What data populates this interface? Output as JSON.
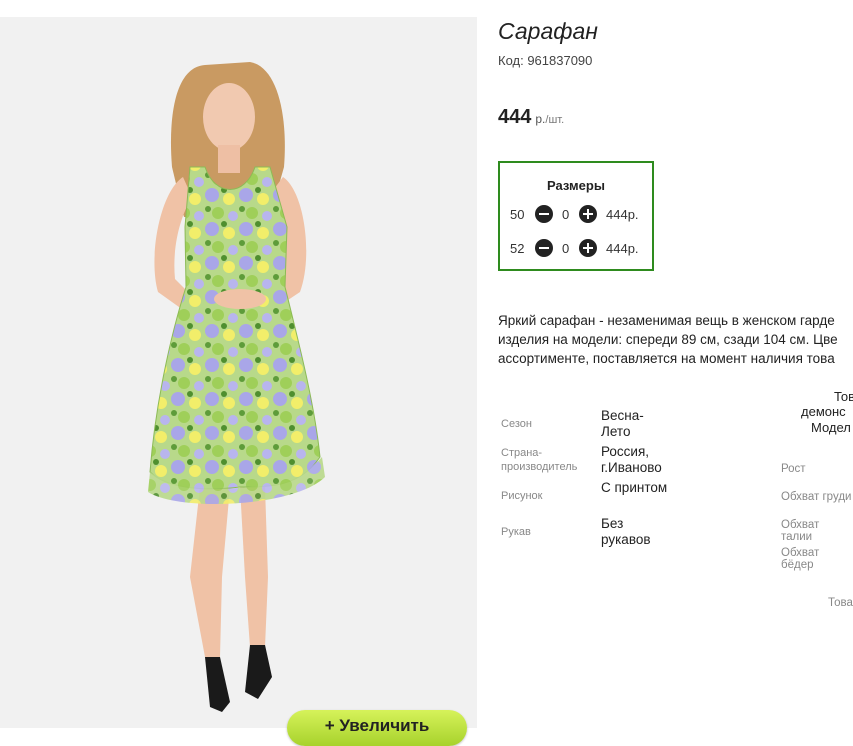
{
  "product": {
    "title": "Сарафан",
    "code": "Код: 961837090",
    "price": "444",
    "price_unit": "р.",
    "price_per": "/шт."
  },
  "sizes": {
    "title": "Размеры",
    "rows": [
      {
        "size": "50",
        "qty": "0",
        "price": "444р."
      },
      {
        "size": "52",
        "qty": "0",
        "price": "444р."
      }
    ]
  },
  "description": {
    "line1": "Яркий сарафан - незаменимая вещь в женском гарде",
    "line2": "изделия на модели: спереди 89 см, сзади 104 см. Цве",
    "line3": "ассортименте, поставляется на момент наличия това"
  },
  "properties": [
    {
      "label": "Сезон",
      "value": "Весна-Лето"
    },
    {
      "label": "Страна-производитель",
      "value": "Россия, г.Иваново"
    },
    {
      "label": "Рисунок",
      "value": "С принтом"
    },
    {
      "label": "Рукав",
      "value": "Без рукавов"
    }
  ],
  "model_info": {
    "header1": "Тов",
    "header2": "демонс",
    "header3": "Модел",
    "labels": [
      "Рост",
      "Обхват груди",
      "Обхват талии",
      "Обхват бёдер"
    ],
    "footer": "Това"
  },
  "zoom_button": "+ Увеличить",
  "icons": {
    "minus": "minus-circle-icon",
    "plus": "plus-circle-icon"
  },
  "colors": {
    "sizes_border": "#2e8b1e",
    "zoom_button": "#b5dd34"
  }
}
